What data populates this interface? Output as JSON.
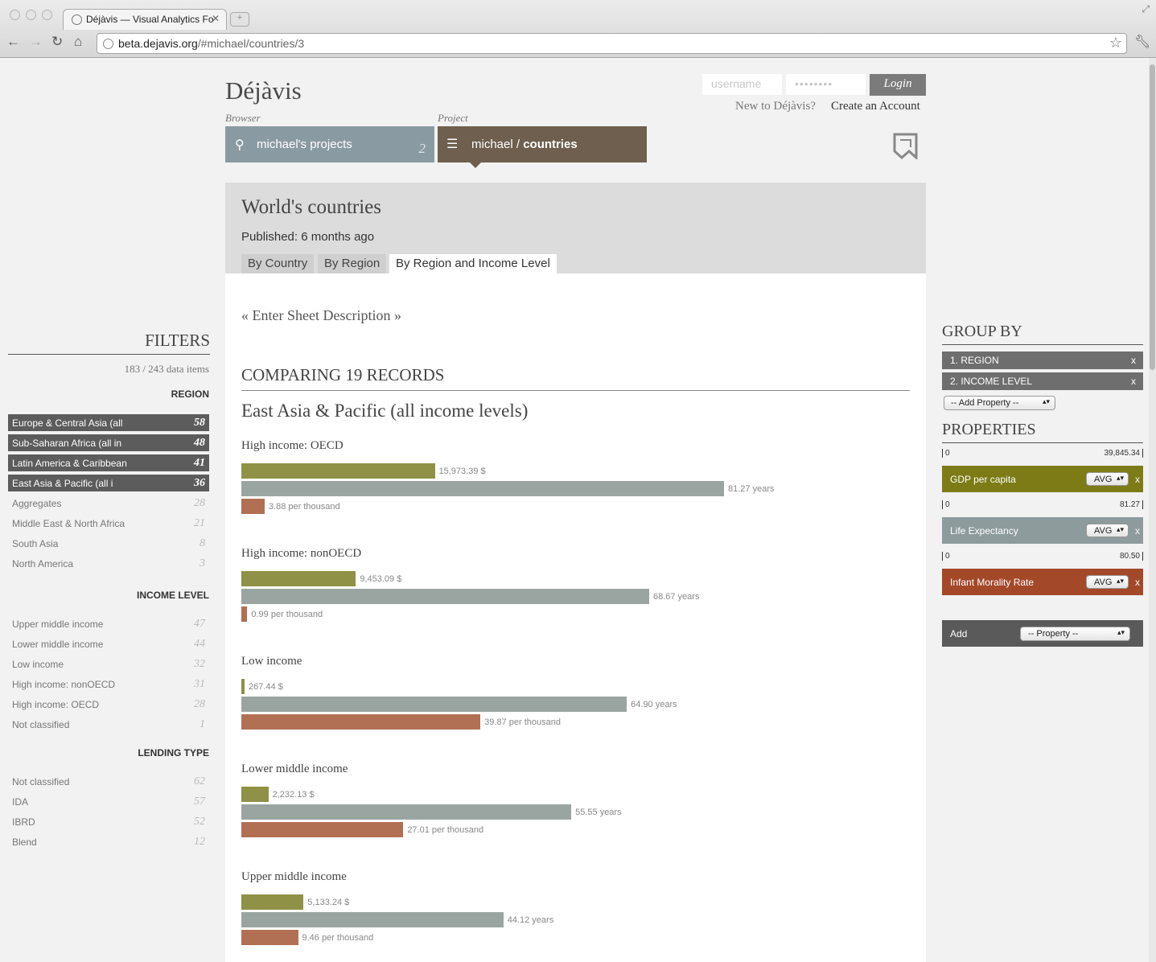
{
  "browser": {
    "tab_title": "Déjàvis — Visual Analytics Fo",
    "url_host": "beta.dejavis.org",
    "url_path": "/#michael/countries/3"
  },
  "header": {
    "logo": "Déjàvis",
    "username_placeholder": "username",
    "password_placeholder": "••••••••",
    "login_label": "Login",
    "new_to": "New to Déjàvis?",
    "create_account": "Create an Account",
    "browser_label": "Browser",
    "project_label": "Project",
    "projects_button": "michael's projects",
    "projects_count": "2",
    "project_owner": "michael / ",
    "project_name": "countries"
  },
  "sheet": {
    "title": "World's countries",
    "published": "Published: 6 months ago",
    "tabs": [
      "By Country",
      "By Region",
      "By Region and Income Level"
    ],
    "active_tab": 2,
    "description": "« Enter Sheet Description »",
    "comparing": "COMPARING 19 RECORDS",
    "group_title": "East Asia & Pacific (all income levels)"
  },
  "chart_data": {
    "type": "bar",
    "title": "East Asia & Pacific (all income levels)",
    "series": [
      {
        "name": "GDP per capita",
        "color": "#8e9146",
        "unit": "$",
        "max": 39845.34
      },
      {
        "name": "Life Expectancy",
        "color": "#9aa5a2",
        "unit": "years",
        "max": 81.27
      },
      {
        "name": "Infant Morality Rate",
        "color": "#b17054",
        "unit": "per thousand",
        "max": 80.5
      }
    ],
    "groups": [
      {
        "label": "High income: OECD",
        "values": [
          15973.39,
          81.27,
          3.88
        ],
        "labels": [
          "15,973.39 $",
          "81.27 years",
          "3.88 per thousand"
        ]
      },
      {
        "label": "High income: nonOECD",
        "values": [
          9453.09,
          68.67,
          0.99
        ],
        "labels": [
          "9,453.09 $",
          "68.67 years",
          "0.99 per thousand"
        ]
      },
      {
        "label": "Low income",
        "values": [
          267.44,
          64.9,
          39.87
        ],
        "labels": [
          "267.44 $",
          "64.90 years",
          "39.87 per thousand"
        ]
      },
      {
        "label": "Lower middle income",
        "values": [
          2232.13,
          55.55,
          27.01
        ],
        "labels": [
          "2,232.13 $",
          "55.55 years",
          "27.01 per thousand"
        ]
      },
      {
        "label": "Upper middle income",
        "values": [
          5133.24,
          44.12,
          9.46
        ],
        "labels": [
          "5,133.24 $",
          "44.12 years",
          "9.46 per thousand"
        ]
      }
    ]
  },
  "filters": {
    "title": "FILTERS",
    "count": "183 / 243 data items",
    "region_title": "REGION",
    "region": [
      {
        "label": "Europe & Central Asia (all",
        "n": "58",
        "sel": true
      },
      {
        "label": "Sub-Saharan Africa (all in",
        "n": "48",
        "sel": true
      },
      {
        "label": "Latin America & Caribbean",
        "n": "41",
        "sel": true
      },
      {
        "label": "East Asia & Pacific (all i",
        "n": "36",
        "sel": true
      },
      {
        "label": "Aggregates",
        "n": "28",
        "sel": false
      },
      {
        "label": "Middle East & North Africa",
        "n": "21",
        "sel": false
      },
      {
        "label": "South Asia",
        "n": "8",
        "sel": false
      },
      {
        "label": "North America",
        "n": "3",
        "sel": false
      }
    ],
    "income_title": "INCOME LEVEL",
    "income": [
      {
        "label": "Upper middle income",
        "n": "47"
      },
      {
        "label": "Lower middle income",
        "n": "44"
      },
      {
        "label": "Low income",
        "n": "32"
      },
      {
        "label": "High income: nonOECD",
        "n": "31"
      },
      {
        "label": "High income: OECD",
        "n": "28"
      },
      {
        "label": "Not classified",
        "n": "1"
      }
    ],
    "lending_title": "LENDING TYPE",
    "lending": [
      {
        "label": "Not classified",
        "n": "62"
      },
      {
        "label": "IDA",
        "n": "57"
      },
      {
        "label": "IBRD",
        "n": "52"
      },
      {
        "label": "Blend",
        "n": "12"
      }
    ]
  },
  "right": {
    "group_by_title": "GROUP BY",
    "group_by": [
      "1. REGION",
      "2. INCOME LEVEL"
    ],
    "add_property": "-- Add Property --",
    "properties_title": "PROPERTIES",
    "properties": [
      {
        "name": "GDP per capita",
        "min": "0",
        "max": "39,845.34",
        "agg": "AVG",
        "color": "#7d7b16"
      },
      {
        "name": "Life Expectancy",
        "min": "0",
        "max": "81.27",
        "agg": "AVG",
        "color": "#8d9b9c"
      },
      {
        "name": "Infant Morality Rate",
        "min": "0",
        "max": "80.50",
        "agg": "AVG",
        "color": "#a4482a"
      }
    ],
    "add_label": "Add",
    "add_select": "-- Property --"
  }
}
